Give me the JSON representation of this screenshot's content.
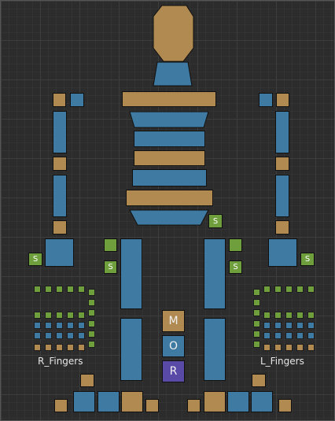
{
  "labels": {
    "right_fingers": "R_Fingers",
    "left_fingers": "L_Fingers"
  },
  "buttons": {
    "m": "M",
    "o": "O",
    "r": "R",
    "s": "S"
  },
  "colors": {
    "fk": "#b08a51",
    "ik": "#3e7aa1",
    "switch": "#6f9e3c",
    "r": "#5a4aa8"
  }
}
